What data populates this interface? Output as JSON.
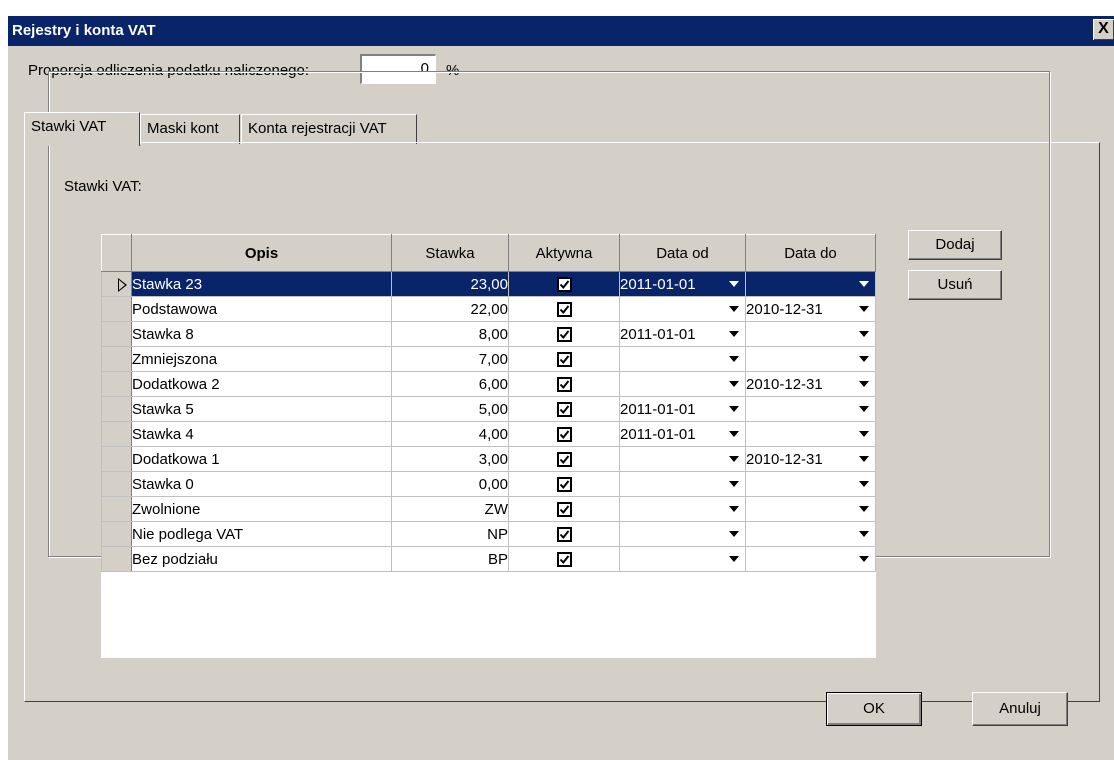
{
  "window": {
    "title": "Rejestry i konta VAT",
    "close_symbol": "X"
  },
  "proportion": {
    "label": "Proporcja odliczenia podatku naliczonego:",
    "value": "0",
    "unit": "%"
  },
  "tabs": [
    {
      "label": "Stawki VAT",
      "active": true
    },
    {
      "label": "Maski kont",
      "active": false
    },
    {
      "label": "Konta rejestracji VAT",
      "active": false
    }
  ],
  "group": {
    "legend": "Stawki VAT:"
  },
  "grid": {
    "columns": {
      "opis": "Opis",
      "stawka": "Stawka",
      "aktywna": "Aktywna",
      "data_od": "Data od",
      "data_do": "Data do"
    },
    "rows": [
      {
        "opis": "Stawka 23",
        "stawka": "23,00",
        "aktywna": true,
        "data_od": "2011-01-01",
        "data_do": "",
        "selected": true
      },
      {
        "opis": "Podstawowa",
        "stawka": "22,00",
        "aktywna": true,
        "data_od": "",
        "data_do": "2010-12-31"
      },
      {
        "opis": "Stawka 8",
        "stawka": "8,00",
        "aktywna": true,
        "data_od": "2011-01-01",
        "data_do": ""
      },
      {
        "opis": "Zmniejszona",
        "stawka": "7,00",
        "aktywna": true,
        "data_od": "",
        "data_do": ""
      },
      {
        "opis": "Dodatkowa 2",
        "stawka": "6,00",
        "aktywna": true,
        "data_od": "",
        "data_do": "2010-12-31"
      },
      {
        "opis": "Stawka 5",
        "stawka": "5,00",
        "aktywna": true,
        "data_od": "2011-01-01",
        "data_do": ""
      },
      {
        "opis": "Stawka 4",
        "stawka": "4,00",
        "aktywna": true,
        "data_od": "2011-01-01",
        "data_do": ""
      },
      {
        "opis": "Dodatkowa 1",
        "stawka": "3,00",
        "aktywna": true,
        "data_od": "",
        "data_do": "2010-12-31"
      },
      {
        "opis": "Stawka 0",
        "stawka": "0,00",
        "aktywna": true,
        "data_od": "",
        "data_do": ""
      },
      {
        "opis": "Zwolnione",
        "stawka": "ZW",
        "aktywna": true,
        "data_od": "",
        "data_do": ""
      },
      {
        "opis": "Nie podlega VAT",
        "stawka": "NP",
        "aktywna": true,
        "data_od": "",
        "data_do": ""
      },
      {
        "opis": "Bez podziału",
        "stawka": "BP",
        "aktywna": true,
        "data_od": "",
        "data_do": ""
      }
    ]
  },
  "buttons": {
    "dodaj": "Dodaj",
    "usun": "Usuń",
    "ok": "OK",
    "anuluj": "Anuluj"
  },
  "colors": {
    "titlebar": "#0a246a",
    "face": "#d4d0c8",
    "selection": "#0a246a"
  }
}
